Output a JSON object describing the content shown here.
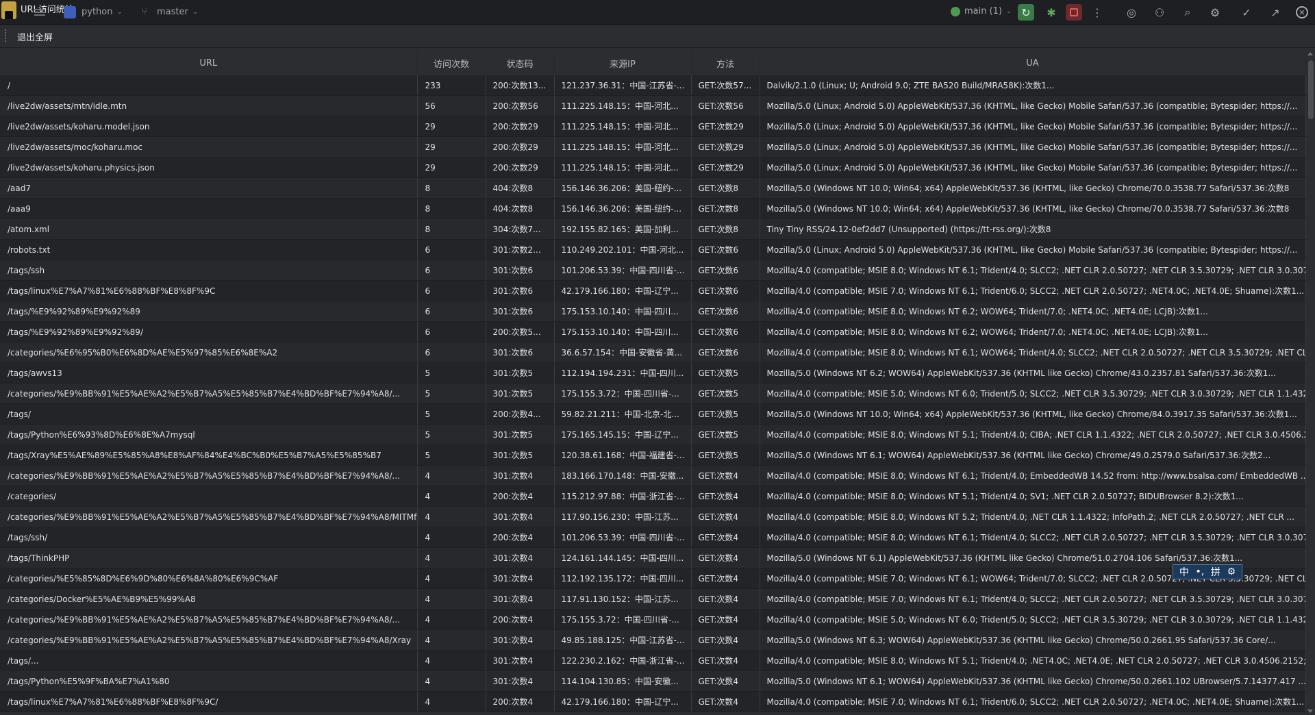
{
  "window": {
    "title": "URL访问统计",
    "project": "python",
    "branch": "master",
    "run_config": "main (1)",
    "exit_fullscreen": "退出全屏"
  },
  "columns": [
    "URL",
    "访问次数",
    "状态码",
    "来源IP",
    "方法",
    "UA"
  ],
  "rows": [
    [
      "/",
      "233",
      "200:次数13...",
      "121.237.36.31：中国-江苏省-...",
      "GET:次数57...",
      "Dalvik/2.1.0 (Linux; U; Android 9.0; ZTE BA520 Build/MRA58K):次数1..."
    ],
    [
      "/live2dw/assets/mtn/idle.mtn",
      "56",
      "200:次数56",
      "111.225.148.15：中国-河北...",
      "GET:次数56",
      "Mozilla/5.0 (Linux; Android 5.0) AppleWebKit/537.36 (KHTML, like Gecko) Mobile Safari/537.36 (compatible; Bytespider; https://..."
    ],
    [
      "/live2dw/assets/koharu.model.json",
      "29",
      "200:次数29",
      "111.225.148.15：中国-河北...",
      "GET:次数29",
      "Mozilla/5.0 (Linux; Android 5.0) AppleWebKit/537.36 (KHTML, like Gecko) Mobile Safari/537.36 (compatible; Bytespider; https://..."
    ],
    [
      "/live2dw/assets/moc/koharu.moc",
      "29",
      "200:次数29",
      "111.225.148.15：中国-河北...",
      "GET:次数29",
      "Mozilla/5.0 (Linux; Android 5.0) AppleWebKit/537.36 (KHTML, like Gecko) Mobile Safari/537.36 (compatible; Bytespider; https://..."
    ],
    [
      "/live2dw/assets/koharu.physics.json",
      "29",
      "200:次数29",
      "111.225.148.15：中国-河北...",
      "GET:次数29",
      "Mozilla/5.0 (Linux; Android 5.0) AppleWebKit/537.36 (KHTML, like Gecko) Mobile Safari/537.36 (compatible; Bytespider; https://..."
    ],
    [
      "/aad7",
      "8",
      "404:次数8",
      "156.146.36.206：美国-纽约-...",
      "GET:次数8",
      "Mozilla/5.0 (Windows NT 10.0; Win64; x64) AppleWebKit/537.36 (KHTML, like Gecko) Chrome/70.0.3538.77 Safari/537.36:次数8"
    ],
    [
      "/aaa9",
      "8",
      "404:次数8",
      "156.146.36.206：美国-纽约-...",
      "GET:次数8",
      "Mozilla/5.0 (Windows NT 10.0; Win64; x64) AppleWebKit/537.36 (KHTML, like Gecko) Chrome/70.0.3538.77 Safari/537.36:次数8"
    ],
    [
      "/atom.xml",
      "8",
      "304:次数7...",
      "192.155.82.165：美国-加利...",
      "GET:次数8",
      "Tiny Tiny RSS/24.12-0ef2dd7 (Unsupported) (https://tt-rss.org/):次数8"
    ],
    [
      "/robots.txt",
      "6",
      "301:次数2...",
      "110.249.202.101：中国-河北...",
      "GET:次数6",
      "Mozilla/5.0 (Linux; Android 5.0) AppleWebKit/537.36 (KHTML, like Gecko) Mobile Safari/537.36 (compatible; Bytespider; https://..."
    ],
    [
      "/tags/ssh",
      "6",
      "301:次数6",
      "101.206.53.39：中国-四川省-...",
      "GET:次数6",
      "Mozilla/4.0 (compatible; MSIE 8.0; Windows NT 6.1; Trident/4.0; SLCC2; .NET CLR 2.0.50727; .NET CLR 3.5.30729; .NET CLR 3.0.30729; ..."
    ],
    [
      "/tags/linux%E7%A7%81%E6%88%BF%E8%8F%9C",
      "6",
      "301:次数6",
      "42.179.166.180：中国-辽宁...",
      "GET:次数6",
      "Mozilla/4.0 (compatible; MSIE 7.0; Windows NT 6.1; Trident/6.0; SLCC2; .NET CLR 2.0.50727; .NET4.0C; .NET4.0E; Shuame):次数1..."
    ],
    [
      "/tags/%E9%92%89%E9%92%89",
      "6",
      "301:次数6",
      "175.153.10.140：中国-四川...",
      "GET:次数6",
      "Mozilla/4.0 (compatible; MSIE 8.0; Windows NT 6.2; WOW64; Trident/7.0; .NET4.0C; .NET4.0E; LCJB):次数1..."
    ],
    [
      "/tags/%E9%92%89%E9%92%89/",
      "6",
      "200:次数5...",
      "175.153.10.140：中国-四川...",
      "GET:次数6",
      "Mozilla/4.0 (compatible; MSIE 8.0; Windows NT 6.2; WOW64; Trident/7.0; .NET4.0C; .NET4.0E; LCJB):次数1..."
    ],
    [
      "/categories/%E6%95%B0%E6%8D%AE%E5%97%85%E6%8E%A2",
      "6",
      "301:次数6",
      "36.6.57.154：中国-安徽省-黄...",
      "GET:次数6",
      "Mozilla/4.0 (compatible; MSIE 8.0; Windows NT 6.1; WOW64; Trident/4.0; SLCC2; .NET CLR 2.0.50727; .NET CLR 3.5.30729; .NET CLR ..."
    ],
    [
      "/tags/awvs13",
      "5",
      "301:次数5",
      "112.194.194.231：中国-四川...",
      "GET:次数5",
      "Mozilla/5.0 (Windows NT 6.2; WOW64) AppleWebKit/537.36 (KHTML like Gecko) Chrome/43.0.2357.81 Safari/537.36:次数1..."
    ],
    [
      "/categories/%E9%BB%91%E5%AE%A2%E5%B7%A5%E5%85%B7%E4%BD%BF%E7%94%A8/...",
      "5",
      "301:次数5",
      "175.155.3.72：中国-四川省-...",
      "GET:次数5",
      "Mozilla/4.0 (compatible; MSIE 5.0; Windows NT 6.0; Trident/5.0; SLCC2; .NET CLR 3.5.30729; .NET CLR 3.0.30729; .NET CLR 1.1.4322; .N..."
    ],
    [
      "/tags/",
      "5",
      "200:次数4...",
      "59.82.21.211：中国-北京-北...",
      "GET:次数5",
      "Mozilla/5.0 (Windows NT 10.0; Win64; x64) AppleWebKit/537.36 (KHTML, like Gecko) Chrome/84.0.3917.35 Safari/537.36:次数1..."
    ],
    [
      "/tags/Python%E6%93%8D%E6%8E%A7mysql",
      "5",
      "301:次数5",
      "175.165.145.15：中国-辽宁...",
      "GET:次数5",
      "Mozilla/4.0 (compatible; MSIE 8.0; Windows NT 5.1; Trident/4.0; CIBA; .NET CLR 1.1.4322; .NET CLR 2.0.50727; .NET CLR 3.0.4506.2152; ..."
    ],
    [
      "/tags/Xray%E5%AE%89%E5%85%A8%E8%AF%84%E4%BC%B0%E5%B7%A5%E5%85%B7",
      "5",
      "301:次数5",
      "120.38.61.168：中国-福建省-...",
      "GET:次数5",
      "Mozilla/5.0 (Windows NT 6.1; WOW64) AppleWebKit/537.36 (KHTML like Gecko) Chrome/49.0.2579.0 Safari/537.36:次数2..."
    ],
    [
      "/categories/%E9%BB%91%E5%AE%A2%E5%B7%A5%E5%85%B7%E4%BD%BF%E7%94%A8/...",
      "4",
      "301:次数4",
      "183.166.170.148：中国-安徽...",
      "GET:次数4",
      "Mozilla/4.0 (compatible; MSIE 8.0; Windows NT 6.1; Trident/4.0; EmbeddedWB 14.52 from: http://www.bsalsa.com/ EmbeddedWB ..."
    ],
    [
      "/categories/",
      "4",
      "200:次数4",
      "115.212.97.88：中国-浙江省-...",
      "GET:次数4",
      "Mozilla/4.0 (compatible; MSIE 8.0; Windows NT 5.1; Trident/4.0; SV1; .NET CLR 2.0.50727; BIDUBrowser 8.2):次数1..."
    ],
    [
      "/categories/%E9%BB%91%E5%AE%A2%E5%B7%A5%E5%85%B7%E4%BD%BF%E7%94%A8/MITMf",
      "4",
      "301:次数4",
      "117.90.156.230：中国-江苏...",
      "GET:次数4",
      "Mozilla/4.0 (compatible; MSIE 8.0; Windows NT 5.2; Trident/4.0; .NET CLR 1.1.4322; InfoPath.2; .NET CLR 2.0.50727; .NET CLR ..."
    ],
    [
      "/tags/ssh/",
      "4",
      "200:次数4",
      "101.206.53.39：中国-四川省-...",
      "GET:次数4",
      "Mozilla/4.0 (compatible; MSIE 8.0; Windows NT 6.1; Trident/4.0; SLCC2; .NET CLR 2.0.50727; .NET CLR 3.5.30729; .NET CLR 3.0.30729; ..."
    ],
    [
      "/tags/ThinkPHP",
      "4",
      "301:次数4",
      "124.161.144.145：中国-四川...",
      "GET:次数4",
      "Mozilla/5.0 (Windows NT 6.1) AppleWebKit/537.36 (KHTML like Gecko) Chrome/51.0.2704.106 Safari/537.36:次数1..."
    ],
    [
      "/categories/%E5%85%8D%E6%9D%80%E6%8A%80%E6%9C%AF",
      "4",
      "301:次数4",
      "112.192.135.172：中国-四川...",
      "GET:次数4",
      "Mozilla/4.0 (compatible; MSIE 7.0; Windows NT 6.1; WOW64; Trident/7.0; SLCC2; .NET CLR 2.0.50727; .NET CLR 3.5.30729; .NET CLR ..."
    ],
    [
      "/categories/Docker%E5%AE%B9%E5%99%A8",
      "4",
      "301:次数4",
      "117.91.130.152：中国-江苏...",
      "GET:次数4",
      "Mozilla/4.0 (compatible; MSIE 7.0; Windows NT 6.1; Trident/4.0; SLCC2; .NET CLR 2.0.50727; .NET CLR 3.5.30729; .NET CLR 3.0.30729; ..."
    ],
    [
      "/categories/%E9%BB%91%E5%AE%A2%E5%B7%A5%E5%85%B7%E4%BD%BF%E7%94%A8/...",
      "4",
      "200:次数4",
      "175.155.3.72：中国-四川省-...",
      "GET:次数4",
      "Mozilla/4.0 (compatible; MSIE 5.0; Windows NT 6.0; Trident/5.0; SLCC2; .NET CLR 3.5.30729; .NET CLR 3.0.30729; .NET CLR 1.1.4322; .N..."
    ],
    [
      "/categories/%E9%BB%91%E5%AE%A2%E5%B7%A5%E5%85%B7%E4%BD%BF%E7%94%A8/Xray",
      "4",
      "301:次数4",
      "49.85.188.125：中国-江苏省-...",
      "GET:次数4",
      "Mozilla/5.0 (Windows NT 6.3; WOW64) AppleWebKit/537.36 (KHTML like Gecko) Chrome/50.0.2661.95 Safari/537.36 Core/..."
    ],
    [
      "/tags/...",
      "4",
      "301:次数4",
      "122.230.2.162：中国-浙江省-...",
      "GET:次数4",
      "Mozilla/4.0 (compatible; MSIE 8.0; Windows NT 5.1; Trident/4.0; .NET4.0C; .NET4.0E; .NET CLR 2.0.50727; .NET CLR 3.0.4506.2152; .NET ..."
    ],
    [
      "/tags/Python%E5%9F%BA%E7%A1%80",
      "4",
      "301:次数4",
      "114.104.130.85：中国-安徽...",
      "GET:次数4",
      "Mozilla/5.0 (Windows NT 6.1; WOW64) AppleWebKit/537.36 (KHTML like Gecko) Chrome/50.0.2661.102 UBrowser/5.7.14377.417 ..."
    ],
    [
      "/tags/linux%E7%A7%81%E6%88%BF%E8%8F%9C/",
      "4",
      "200:次数4",
      "42.179.166.180：中国-辽宁...",
      "GET:次数4",
      "Mozilla/4.0 (compatible; MSIE 7.0; Windows NT 6.1; Trident/6.0; SLCC2; .NET CLR 2.0.50727; .NET4.0C; .NET4.0E; Shuame):次数1..."
    ]
  ],
  "ime": {
    "mode": "中",
    "punct": "•,",
    "layout": "拼",
    "settings": "⚙"
  }
}
